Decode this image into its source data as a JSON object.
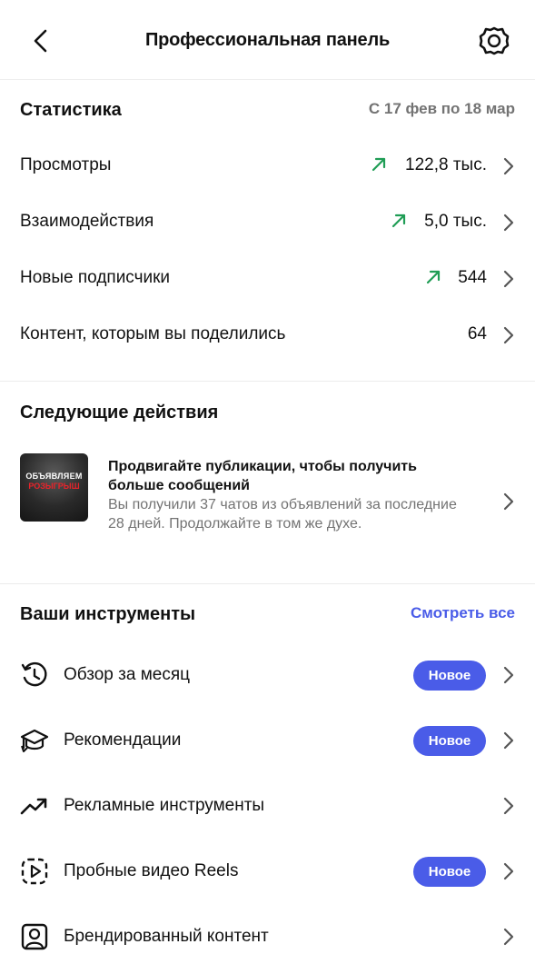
{
  "header": {
    "title": "Профессиональная панель"
  },
  "stats": {
    "title": "Статистика",
    "date_range": "С 17 фев по 18 мар",
    "rows": [
      {
        "label": "Просмотры",
        "value": "122,8 тыс.",
        "trend": "up"
      },
      {
        "label": "Взаимодействия",
        "value": "5,0 тыс.",
        "trend": "up"
      },
      {
        "label": "Новые подписчики",
        "value": "544",
        "trend": "up"
      },
      {
        "label": "Контент, которым вы поделились",
        "value": "64",
        "trend": "none"
      }
    ]
  },
  "next_actions": {
    "title": "Следующие действия",
    "card": {
      "thumbnail_text_1": "ОБЪЯВЛЯЕМ",
      "thumbnail_text_2": "РОЗЫГРЫШ",
      "title": "Продвигайте публикации, чтобы получить больше сообщений",
      "description": "Вы получили 37 чатов из объявлений за последние 28 дней. Продолжайте в том же духе."
    }
  },
  "tools": {
    "title": "Ваши инструменты",
    "see_all": "Смотреть все",
    "items": [
      {
        "label": "Обзор за месяц",
        "icon": "history-icon",
        "badge": "Новое"
      },
      {
        "label": "Рекомендации",
        "icon": "graduation-cap-icon",
        "badge": "Новое"
      },
      {
        "label": "Рекламные инструменты",
        "icon": "trending-up-icon",
        "badge": ""
      },
      {
        "label": "Пробные видео Reels",
        "icon": "reels-trial-icon",
        "badge": "Новое"
      },
      {
        "label": "Брендированный контент",
        "icon": "branded-content-icon",
        "badge": ""
      }
    ]
  },
  "colors": {
    "accent": "#4a5ce8",
    "trend_up": "#1f9d55",
    "muted": "#737373"
  }
}
